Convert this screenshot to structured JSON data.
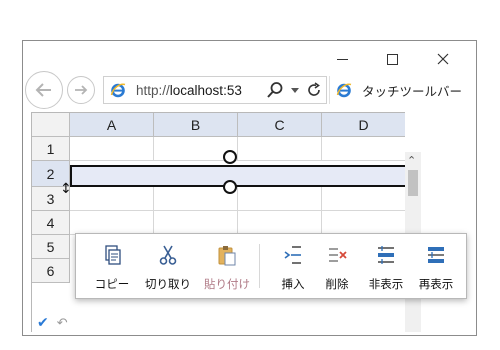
{
  "window": {
    "minimize_label": "minimize",
    "maximize_label": "maximize",
    "close_label": "✕"
  },
  "browser": {
    "url_prefix": "http://",
    "url_host": "localhost:53",
    "tab_title": "タッチツールバー"
  },
  "grid": {
    "columns": [
      "A",
      "B",
      "C",
      "D"
    ],
    "rows": [
      "1",
      "2",
      "3",
      "4",
      "5",
      "6"
    ],
    "selected_row": "2"
  },
  "toolbar": {
    "items": [
      {
        "label": "コピー",
        "icon": "copy-icon",
        "enabled": true
      },
      {
        "label": "切り取り",
        "icon": "cut-icon",
        "enabled": true
      },
      {
        "label": "貼り付け",
        "icon": "paste-icon",
        "enabled": false
      },
      {
        "label": "挿入",
        "icon": "insert-row-icon",
        "enabled": true
      },
      {
        "label": "削除",
        "icon": "delete-row-icon",
        "enabled": true
      },
      {
        "label": "非表示",
        "icon": "hide-row-icon",
        "enabled": true
      },
      {
        "label": "再表示",
        "icon": "unhide-row-icon",
        "enabled": true
      }
    ]
  },
  "colors": {
    "accent": "#2a7ad6",
    "header_selected": "#dde4f1",
    "disabled_text": "#b07a86"
  }
}
